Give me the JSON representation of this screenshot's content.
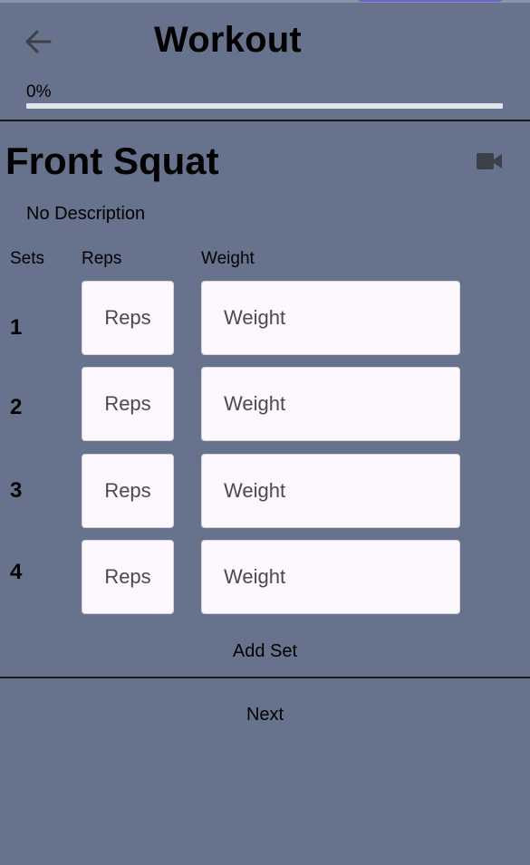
{
  "header": {
    "title": "Workout",
    "progress_label": "0%",
    "progress_value": 0,
    "back_icon": "arrow-left-icon"
  },
  "exercise": {
    "name": "Front Squat",
    "description": "No Description",
    "video_icon": "video-camera-icon"
  },
  "table": {
    "col_sets": "Sets",
    "col_reps": "Reps",
    "col_weight": "Weight",
    "rows": [
      {
        "set": "1",
        "reps_placeholder": "Reps",
        "weight_placeholder": "Weight"
      },
      {
        "set": "2",
        "reps_placeholder": "Reps",
        "weight_placeholder": "Weight"
      },
      {
        "set": "3",
        "reps_placeholder": "Reps",
        "weight_placeholder": "Weight"
      },
      {
        "set": "4",
        "reps_placeholder": "Reps",
        "weight_placeholder": "Weight"
      }
    ]
  },
  "actions": {
    "add_set": "Add Set",
    "next": "Next"
  },
  "colors": {
    "background": "#67738d",
    "accent": "#6a64c8",
    "field": "#fcf8fd"
  }
}
